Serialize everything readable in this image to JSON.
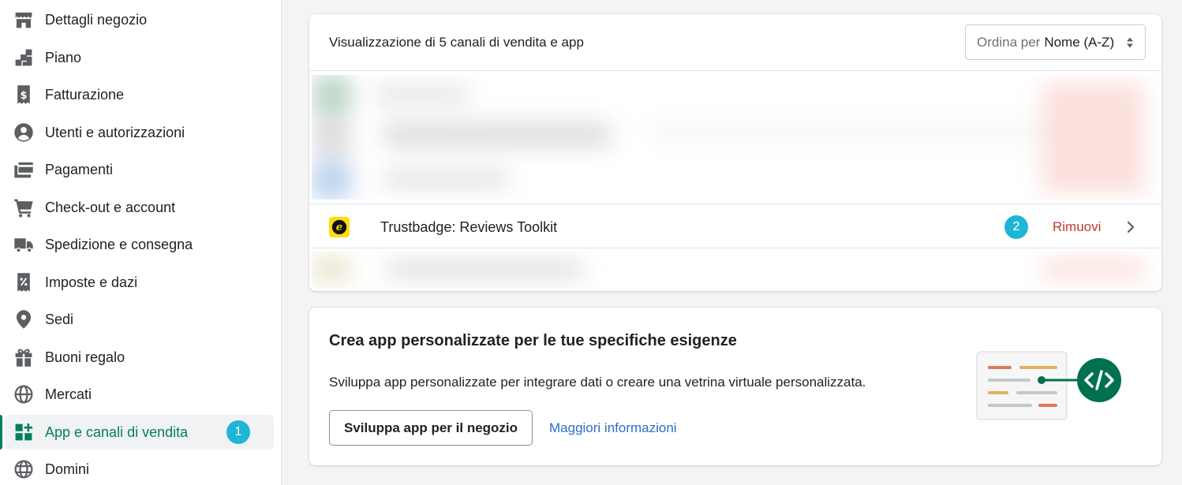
{
  "sidebar": {
    "items": [
      {
        "label": "Dettagli negozio",
        "icon": "store-icon"
      },
      {
        "label": "Piano",
        "icon": "plan-icon"
      },
      {
        "label": "Fatturazione",
        "icon": "billing-icon"
      },
      {
        "label": "Utenti e autorizzazioni",
        "icon": "user-icon"
      },
      {
        "label": "Pagamenti",
        "icon": "payments-icon"
      },
      {
        "label": "Check-out e account",
        "icon": "cart-icon"
      },
      {
        "label": "Spedizione e consegna",
        "icon": "truck-icon"
      },
      {
        "label": "Imposte e dazi",
        "icon": "tax-icon"
      },
      {
        "label": "Sedi",
        "icon": "location-icon"
      },
      {
        "label": "Buoni regalo",
        "icon": "gift-icon"
      },
      {
        "label": "Mercati",
        "icon": "globe-icon"
      },
      {
        "label": "App e canali di vendita",
        "icon": "apps-icon",
        "active": true,
        "badge": "1"
      },
      {
        "label": "Domini",
        "icon": "domains-icon"
      }
    ]
  },
  "channels_card": {
    "header_text": "Visualizzazione di 5 canali di vendita e app",
    "sort": {
      "prefix": "Ordina per",
      "value": "Nome (A-Z)"
    },
    "app": {
      "name": "Trustbadge: Reviews Toolkit",
      "badge": "2",
      "remove_label": "Rimuovi"
    }
  },
  "custom_apps_card": {
    "title": "Crea app personalizzate per le tue specifiche esigenze",
    "description": "Sviluppa app personalizzate per integrare dati o creare una vetrina virtuale personalizzata.",
    "primary_button": "Sviluppa app per il negozio",
    "link": "Maggiori informazioni"
  },
  "colors": {
    "accent": "#008060",
    "badge": "#1fb6d6",
    "danger": "#bf3b2b",
    "link": "#2c6ecb",
    "trustbadge": "#ffdc0f"
  }
}
